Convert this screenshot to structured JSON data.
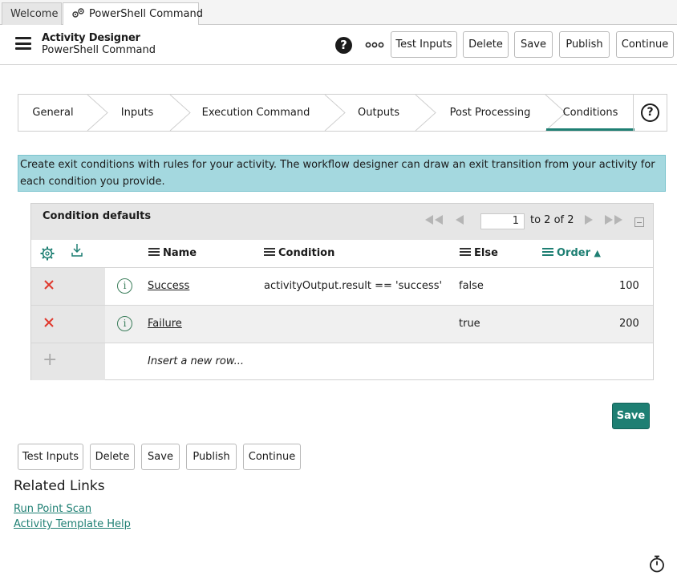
{
  "tabs": [
    {
      "label": "Welcome"
    },
    {
      "label": "PowerShell Command"
    }
  ],
  "header": {
    "title": "Activity Designer",
    "subtitle": "PowerShell Command",
    "buttons": [
      "Test Inputs",
      "Delete",
      "Save",
      "Publish",
      "Continue"
    ]
  },
  "steps": [
    {
      "label": "General"
    },
    {
      "label": "Inputs"
    },
    {
      "label": "Execution Command"
    },
    {
      "label": "Outputs"
    },
    {
      "label": "Post Processing"
    },
    {
      "label": "Conditions",
      "active": true
    }
  ],
  "banner": "Create exit conditions with rules for your activity. The workflow designer can draw an exit transition from your activity for each condition you provide.",
  "list": {
    "title": "Condition defaults",
    "page_input": "1",
    "page_of": "to 2 of 2",
    "columns": [
      "Name",
      "Condition",
      "Else",
      "Order"
    ],
    "sort_column": "Order",
    "sort_direction": "ascending",
    "rows": [
      {
        "name": "Success",
        "condition": "activityOutput.result == 'success'",
        "else": "false",
        "order": "100"
      },
      {
        "name": "Failure",
        "condition": "",
        "else": "true",
        "order": "200"
      }
    ],
    "insert_row": "Insert a new row..."
  },
  "save_button": "Save",
  "bottom_buttons": [
    "Test Inputs",
    "Delete",
    "Save",
    "Publish",
    "Continue"
  ],
  "related_links": {
    "title": "Related Links",
    "links": [
      "Run Point Scan",
      "Activity Template Help"
    ]
  },
  "colors": {
    "accent": "#1e7f73",
    "banner_bg": "#a4d8df",
    "delete_red": "#e03a2f"
  },
  "icons": [
    "gears-icon",
    "hamburger-menu-icon",
    "help-icon",
    "more-icon",
    "settings-gear-icon",
    "export-icon",
    "delete-x-icon",
    "info-icon",
    "plus-icon",
    "stopwatch-icon"
  ]
}
